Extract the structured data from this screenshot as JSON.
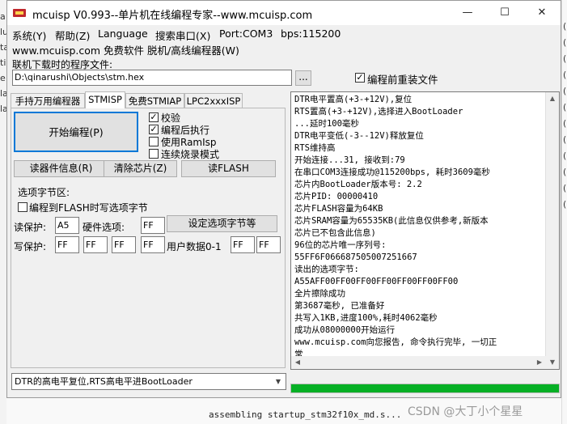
{
  "background": {
    "left_fragments": [
      "a",
      "lu",
      "ta",
      "ti",
      "e",
      "la",
      "la"
    ],
    "right_fragments": [
      "(",
      "(",
      "(",
      "(",
      "(",
      "(",
      "(",
      "(",
      "(",
      "(",
      "(",
      "("
    ],
    "bottom_text": "assembling startup_stm32f10x_md.s..."
  },
  "window": {
    "title": "mcuisp V0.993--单片机在线编程专家--www.mcuisp.com",
    "minimize_glyph": "—",
    "maximize_glyph": "☐",
    "close_glyph": "✕"
  },
  "menu": [
    "系统(Y)",
    "帮助(Z)",
    "Language",
    "搜索串口(X)",
    "Port:COM3",
    "bps:115200"
  ],
  "subtitle": "www.mcuisp.com 免费软件 脱机/高线编程器(W)",
  "file": {
    "label": "联机下载时的程序文件:",
    "path": "D:\\qinarushi\\Objects\\stm.hex",
    "browse_label": "...",
    "reload_checked": true,
    "reload_label": "编程前重装文件"
  },
  "tabs": [
    "手持万用编程器",
    "STMISP",
    "免费STMIAP",
    "LPC2xxxISP"
  ],
  "active_tab": 1,
  "program_button": "开始编程(P)",
  "options": [
    {
      "label": "校验",
      "checked": true
    },
    {
      "label": "编程后执行",
      "checked": true
    },
    {
      "label": "使用RamIsp",
      "checked": false
    },
    {
      "label": "连续烧录模式",
      "checked": false
    }
  ],
  "buttons": {
    "read_info": "读器件信息(R)",
    "erase": "清除芯片(Z)",
    "read_flash": "读FLASH"
  },
  "option_bytes": {
    "group_label": "选项字节区:",
    "write_after_label": "编程到FLASH时写选项字节",
    "write_after_checked": false,
    "read_protect_label": "读保护:",
    "read_protect_value": "A5",
    "hw_option_label": "硬件选项:",
    "hw_option_value": "FF",
    "set_button": "设定选项字节等",
    "write_protect_label": "写保护:",
    "write_protect_values": [
      "FF",
      "FF",
      "FF",
      "FF"
    ],
    "user_data_label": "用户数据0-1",
    "user_data_values": [
      "FF",
      "FF"
    ]
  },
  "log": [
    "DTR电平置高(+3-+12V),复位",
    "RTS置高(+3-+12V),选择进入BootLoader",
    "...延时100毫秒",
    "DTR电平变低(-3--12V)释放复位",
    "RTS维持高",
    "开始连接...31, 接收到:79",
    "在串口COM3连接成功@115200bps, 耗时3609毫秒",
    "芯片内BootLoader版本号: 2.2",
    "芯片PID: 00000410",
    "芯片FLASH容量为64KB",
    "芯片SRAM容量为65535KB(此信息仅供参考,新版本",
    "芯片已不包含此信息)",
    "96位的芯片唯一序列号:",
    "55FF6F066687505007251667",
    "读出的选项字节:",
    "A55AFF00FF00FF00FF00FF00FF00FF00",
    "全片擦除成功",
    "第3687毫秒, 已准备好",
    "共写入1KB,进度100%,耗时4062毫秒",
    "成功从08000000开始运行",
    "www.mcuisp.com向您报告, 命令执行完毕, 一切正",
    "常"
  ],
  "progress_fraction": 1.0,
  "progress_color": "#06b025",
  "bootloader_select": "DTR的高电平复位,RTS高电平进BootLoader",
  "watermark": "CSDN @大丁小个星星"
}
